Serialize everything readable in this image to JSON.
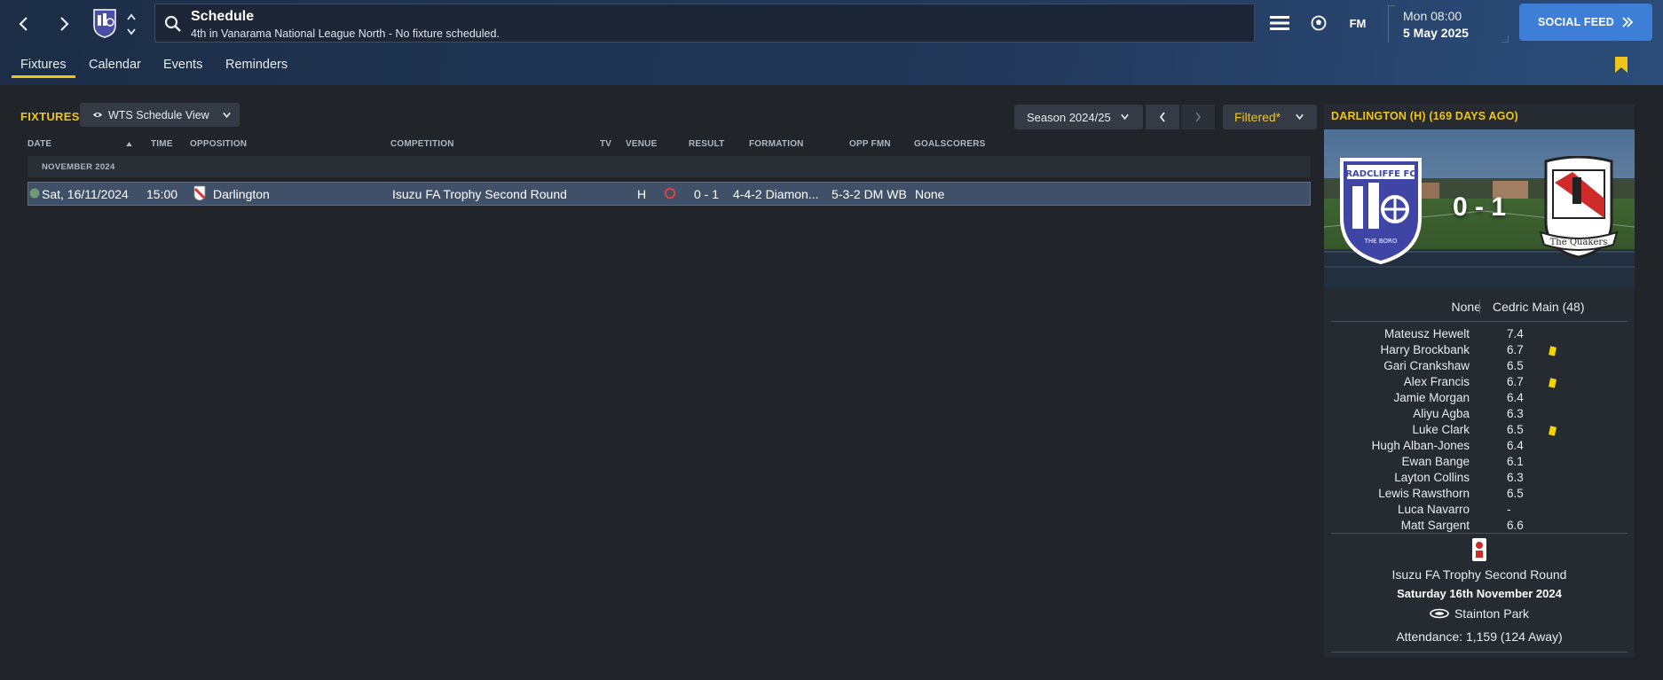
{
  "header": {
    "title": "Schedule",
    "subtitle": "4th in Vanarama National League North - No fixture scheduled.",
    "time": "Mon 08:00",
    "date": "5 May 2025",
    "fm_label": "FM",
    "social_feed_label": "SOCIAL FEED"
  },
  "tabs": [
    {
      "label": "Fixtures",
      "active": true
    },
    {
      "label": "Calendar",
      "active": false
    },
    {
      "label": "Events",
      "active": false
    },
    {
      "label": "Reminders",
      "active": false
    }
  ],
  "fixtures_panel": {
    "title": "FIXTURES",
    "view_label": "WTS Schedule View",
    "season_label": "Season 2024/25",
    "filter_label": "Filtered*",
    "columns": [
      "DATE",
      "TIME",
      "OPPOSITION",
      "COMPETITION",
      "TV",
      "VENUE",
      "RESULT",
      "FORMATION",
      "OPP FMN",
      "GOALSCORERS"
    ],
    "group_label": "NOVEMBER 2024",
    "rows": [
      {
        "date": "Sat, 16/11/2024",
        "time": "15:00",
        "opposition": "Darlington",
        "competition": "Isuzu FA Trophy Second Round",
        "tv": "",
        "venue": "H",
        "result": "0 - 1",
        "formation": "4-4-2 Diamon...",
        "opp_formation": "5-3-2 DM WB",
        "goalscorers": "None"
      }
    ]
  },
  "match_panel": {
    "title": "DARLINGTON (H) (169 DAYS AGO)",
    "score": "0 - 1",
    "home_badge_text": "RADCLIFFE FC",
    "home_badge_sub": "THE BORO",
    "away_badge_text": "The Quakers",
    "home_scorers": "None",
    "away_scorers": "Cedric Main (48)",
    "players": [
      {
        "name": "Mateusz Hewelt",
        "rating": "7.4",
        "yellow": false
      },
      {
        "name": "Harry Brockbank",
        "rating": "6.7",
        "yellow": true
      },
      {
        "name": "Gari Crankshaw",
        "rating": "6.5",
        "yellow": false
      },
      {
        "name": "Alex Francis",
        "rating": "6.7",
        "yellow": true
      },
      {
        "name": "Jamie Morgan",
        "rating": "6.4",
        "yellow": false
      },
      {
        "name": "Aliyu Agba",
        "rating": "6.3",
        "yellow": false
      },
      {
        "name": "Luke Clark",
        "rating": "6.5",
        "yellow": true
      },
      {
        "name": "Hugh Alban-Jones",
        "rating": "6.4",
        "yellow": false
      },
      {
        "name": "Ewan Bange",
        "rating": "6.1",
        "yellow": false
      },
      {
        "name": "Layton Collins",
        "rating": "6.3",
        "yellow": false
      },
      {
        "name": "Lewis Rawsthorn",
        "rating": "6.5",
        "yellow": false
      },
      {
        "name": "Luca Navarro",
        "rating": "-",
        "yellow": false
      },
      {
        "name": "Matt Sargent",
        "rating": "6.6",
        "yellow": false
      }
    ],
    "competition": "Isuzu FA Trophy Second Round",
    "match_date": "Saturday 16th November 2024",
    "stadium": "Stainton Park",
    "attendance": "Attendance: 1,159 (124 Away)"
  },
  "colors": {
    "accent": "#f0c419",
    "social_button": "#3d7ed6",
    "selected_row": "#3f5068",
    "yellow_card": "#f5d400",
    "loss_indicator": "#e04040"
  }
}
